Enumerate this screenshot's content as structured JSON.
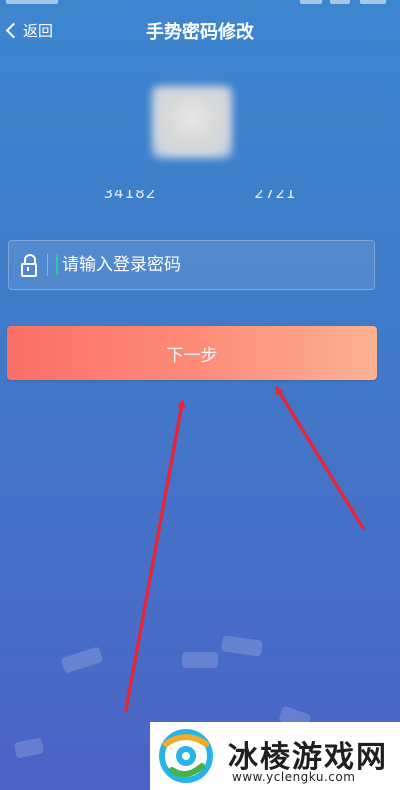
{
  "header": {
    "back_label": "返回",
    "title": "手势密码修改"
  },
  "account": {
    "id_masked": "34182                 2721"
  },
  "password": {
    "placeholder": "请输入登录密码",
    "value": ""
  },
  "actions": {
    "next_label": "下一步"
  },
  "watermark": {
    "title": "冰棱游戏网",
    "url": "www.yclengku.com"
  },
  "colors": {
    "background_top": "#3d86cf",
    "background_bottom": "#4c63c5",
    "button_start": "#fb6f67",
    "button_end": "#fcb192",
    "arrow": "#e0283a",
    "caret": "#2ec8a8"
  },
  "icons": {
    "back": "chevron-left-icon",
    "lock": "lock-icon",
    "logo": "watermark-logo-icon"
  }
}
